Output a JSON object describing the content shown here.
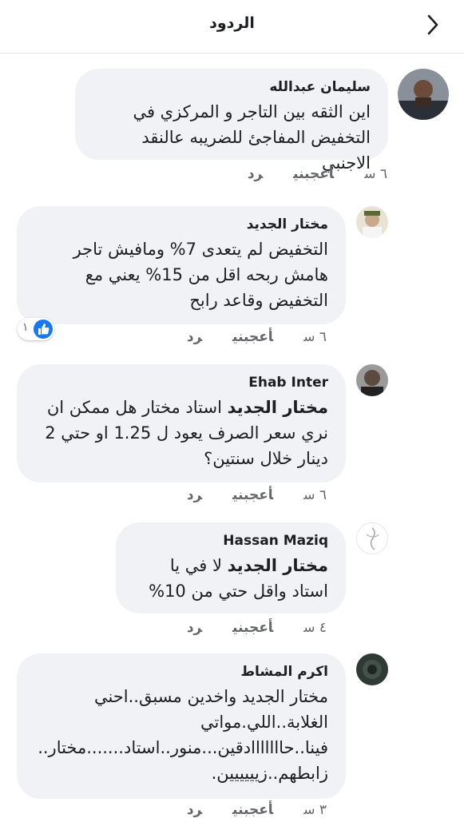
{
  "header": {
    "title": "الردود"
  },
  "actions": {
    "like": "أعجبني",
    "reply": "رد"
  },
  "comments": [
    {
      "author": "سليمان عبدالله",
      "text": "اين الثقه بين التاجر و المركزي في التخفيض المفاجئ للضريبه عالنقد الاجنبي",
      "mention": "",
      "time": "٦ س"
    },
    {
      "author": "مختار الجديد",
      "text": "التخفيض لم يتعدى 7% ومافيش تاجر هامش ربحه اقل من 15% يعني مع التخفيض وقاعد رابح",
      "mention": "",
      "time": "٦ س",
      "likes": "١"
    },
    {
      "author": "Ehab Inter",
      "mention": "مختار الجديد",
      "text": "استاد مختار هل ممكن ان نري سعر الصرف يعود ل 1.25 او حتي 2 دينار خلال سنتين؟",
      "time": "٦ س"
    },
    {
      "author": "Hassan Maziq",
      "mention": "مختار الجديد",
      "text": "لا في يا استاد واقل حتي من 10%",
      "time": "٤ س"
    },
    {
      "author": "اكرم المشاط",
      "text": "مختار الجديد   واخدين مسبق..احني الغلابة..اللي.مواتي فينا..حااااااادقين...منور..استاد.......مختار.. زابطهم..زيييييين.",
      "mention": "",
      "time": "٣ س"
    }
  ],
  "colors": {
    "bubble": "#f0f2f5",
    "like_blue": "#1877f2",
    "meta_gray": "#65676b"
  }
}
